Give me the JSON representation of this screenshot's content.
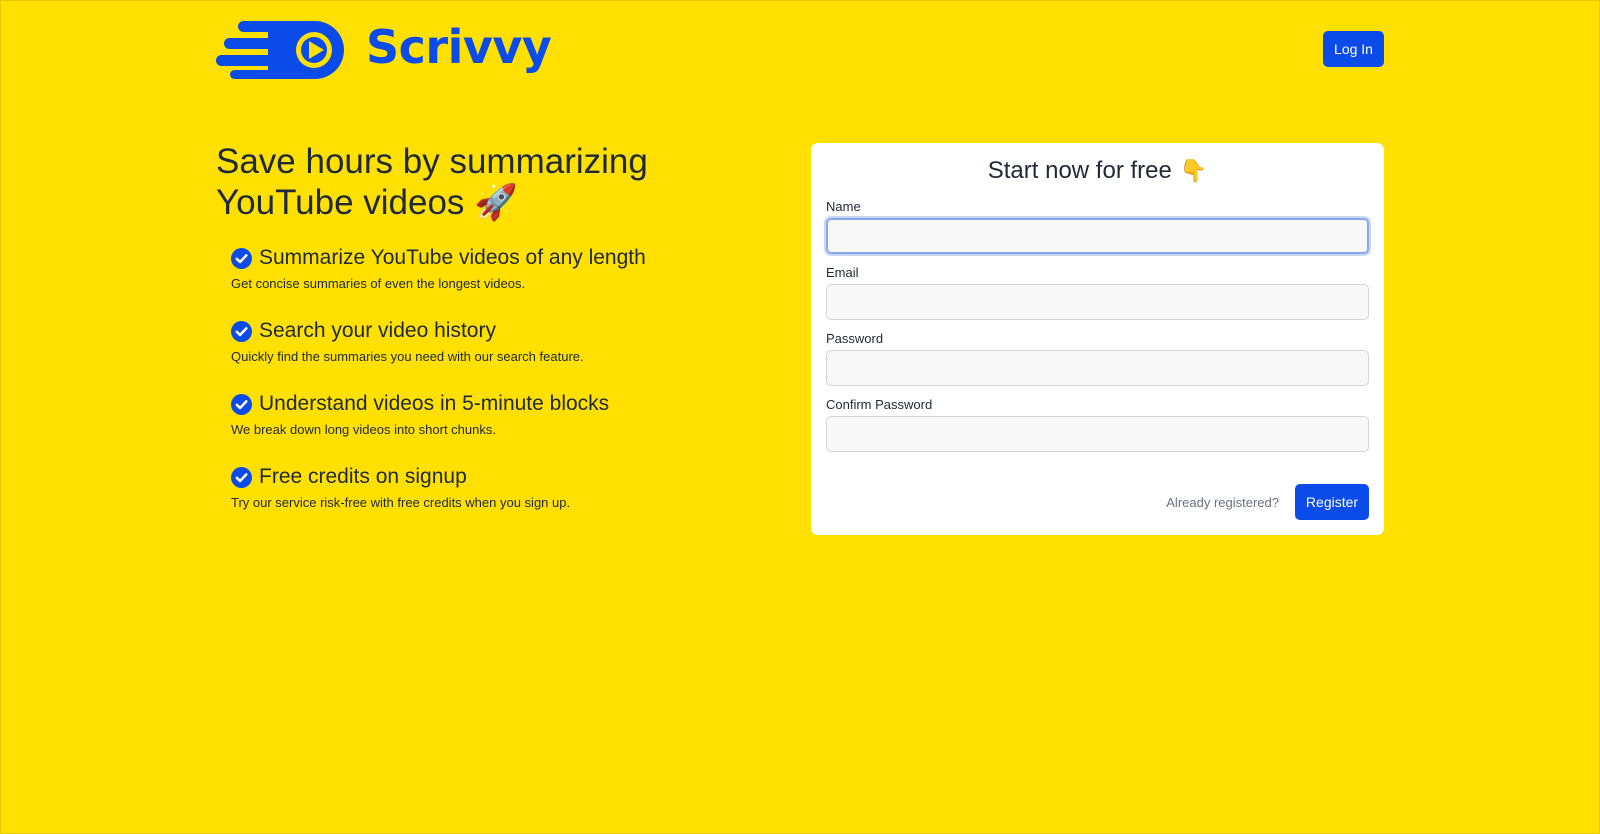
{
  "brand": {
    "name": "Scrivvy",
    "accent": "#0A4BEA",
    "background": "#FFE000"
  },
  "header": {
    "login_label": "Log In"
  },
  "hero": {
    "title": "Save hours by summarizing YouTube videos",
    "title_emoji": "🚀"
  },
  "features": [
    {
      "icon": "check-circle-icon",
      "title": "Summarize YouTube videos of any length",
      "desc": "Get concise summaries of even the longest videos."
    },
    {
      "icon": "check-circle-icon",
      "title": "Search your video history",
      "desc": "Quickly find the summaries you need with our search feature."
    },
    {
      "icon": "check-circle-icon",
      "title": "Understand videos in 5-minute blocks",
      "desc": "We break down long videos into short chunks."
    },
    {
      "icon": "check-circle-icon",
      "title": "Free credits on signup",
      "desc": "Try our service risk-free with free credits when you sign up."
    }
  ],
  "form": {
    "title": "Start now for free",
    "title_emoji": "👇",
    "fields": {
      "name": {
        "label": "Name",
        "value": ""
      },
      "email": {
        "label": "Email",
        "value": ""
      },
      "password": {
        "label": "Password",
        "value": ""
      },
      "confirm_password": {
        "label": "Confirm Password",
        "value": ""
      }
    },
    "already_registered": "Already registered?",
    "submit_label": "Register"
  }
}
